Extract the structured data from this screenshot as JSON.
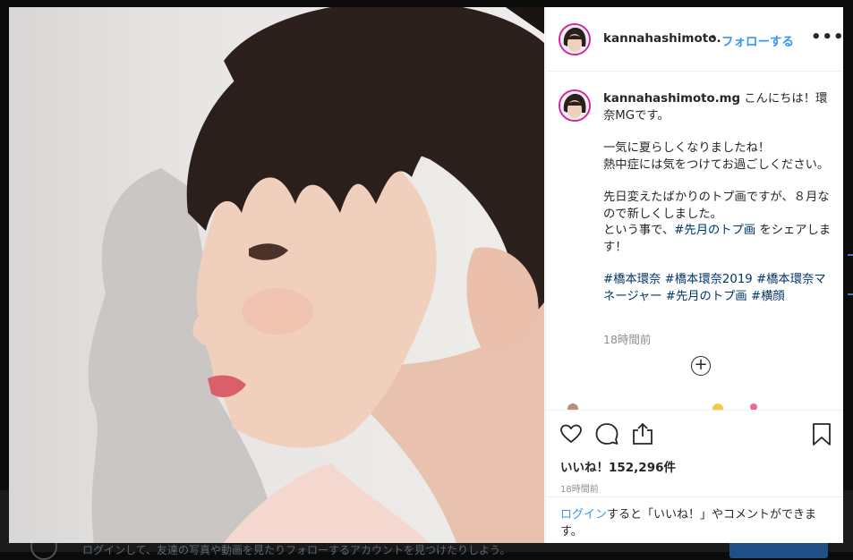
{
  "post": {
    "username": "kannahashimoto.",
    "follow_label": "フォローする",
    "more_label": "•••",
    "caption_username": "kannahashimoto.mg",
    "caption_line1": "こんにちは！環奈MGです。",
    "caption_para2": "一気に夏らしくなりましたね！\n熱中症には気をつけてお過ごしください。",
    "caption_para3_a": "先日変えたばかりのトプ画ですが、８月なので新しくしました。\nという事で、",
    "caption_para3_tag": "#先月のトプ画",
    "caption_para3_b": " をシェアします！",
    "hashtags": [
      "#橋本環奈",
      "#橋本環奈2019",
      "#橋本環奈マネージャー",
      "#先月のトプ画",
      "#横顔"
    ],
    "caption_time": "18時間前",
    "likes": "いいね！152,296件",
    "post_time": "18時間前",
    "login_link": "ログイン",
    "login_rest": "すると「いいね！」やコメントができます。"
  },
  "background_page": {
    "footer_text": "ログインして、友達の写真や動画を見たりフォローするアカウントを見つけたりしよう。"
  },
  "colors": {
    "link_blue": "#3897f0",
    "hashtag_blue": "#003569",
    "text": "#262626",
    "muted": "#8e8e8e"
  },
  "icons": {
    "like": "heart-icon",
    "comment": "comment-icon",
    "share": "share-icon",
    "save": "bookmark-icon",
    "add_comment": "plus-circle-icon"
  }
}
